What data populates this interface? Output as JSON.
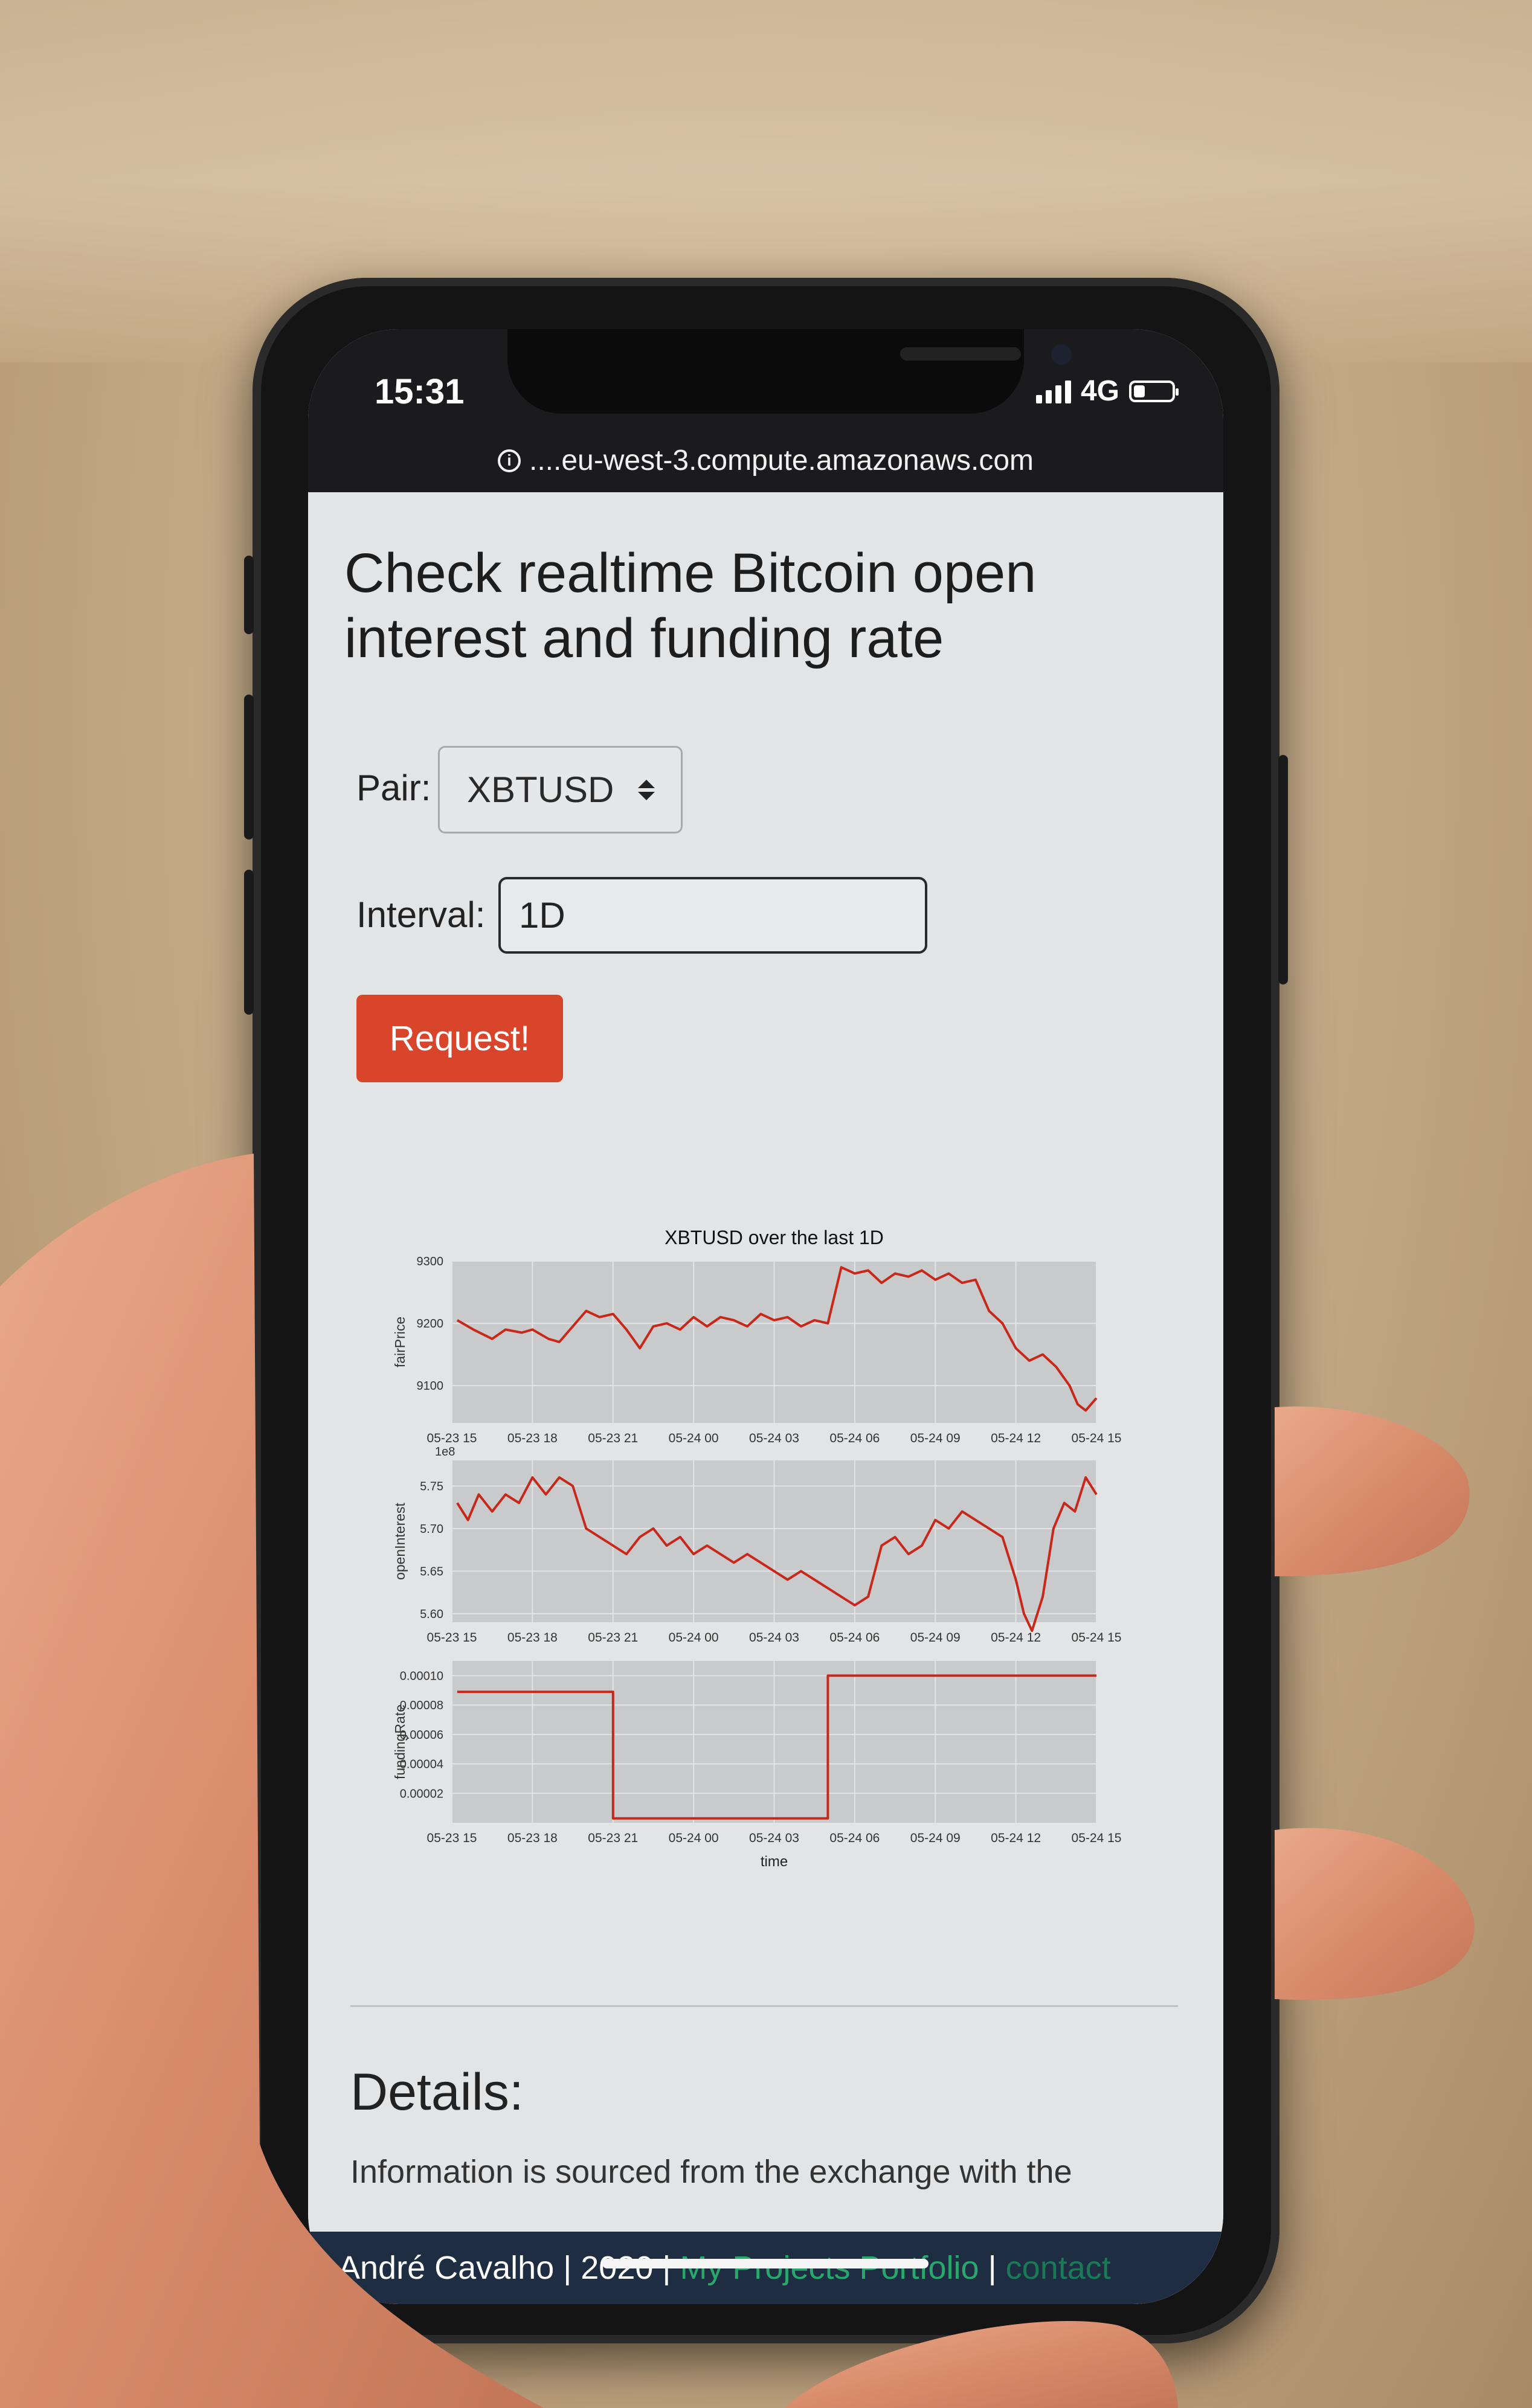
{
  "status": {
    "time": "15:31",
    "network": "4G",
    "battery_level": 0.3
  },
  "url_bar": {
    "url": "....eu-west-3.compute.amazonaws.com"
  },
  "page": {
    "title": "Check realtime Bitcoin open interest and funding rate",
    "pair_label": "Pair:",
    "pair_value": "XBTUSD",
    "interval_label": "Interval:",
    "interval_value": "1D",
    "request_button": "Request!",
    "details_title": "Details:",
    "details_text": "Information is sourced from the exchange with the"
  },
  "footer": {
    "author": "André Cavalho | 2020 |",
    "portfolio_link": "My Projects Portfolio",
    "separator": "|",
    "contact_link": "contact"
  },
  "colors": {
    "accent_button": "#d9452a",
    "series_line": "#c8281a",
    "plot_bg": "#c9cacc",
    "footer_bg": "#1e2d42",
    "footer_link": "#28a96b"
  },
  "icons": [
    "info-icon",
    "signal-icon",
    "battery-icon",
    "select-arrows-icon"
  ],
  "chart_data": {
    "type": "line",
    "title": "XBTUSD over the last 1D",
    "xlabel": "time",
    "x_tick_labels": [
      "05-23 15",
      "05-23 18",
      "05-23 21",
      "05-24 00",
      "05-24 03",
      "05-24 06",
      "05-24 09",
      "05-24 12",
      "05-24 15"
    ],
    "x_hours": [
      0,
      3,
      6,
      9,
      12,
      15,
      18,
      21,
      24
    ],
    "panels": [
      {
        "ylabel": "fairPrice",
        "ylim": [
          9040,
          9300
        ],
        "yticks": [
          9100,
          9200,
          9300
        ],
        "ytick_labels": [
          "9100",
          "9200",
          "9300"
        ],
        "offset_label": "",
        "step": false,
        "x": [
          0.2,
          0.8,
          1.5,
          2.0,
          2.6,
          3.0,
          3.6,
          4.0,
          4.5,
          5.0,
          5.5,
          6.0,
          6.5,
          7.0,
          7.5,
          8.0,
          8.5,
          9.0,
          9.5,
          10.0,
          10.5,
          11.0,
          11.5,
          12.0,
          12.5,
          13.0,
          13.5,
          14.0,
          14.5,
          15.0,
          15.5,
          16.0,
          16.5,
          17.0,
          17.5,
          18.0,
          18.5,
          19.0,
          19.5,
          20.0,
          20.5,
          21.0,
          21.5,
          22.0,
          22.5,
          23.0,
          23.3,
          23.6,
          24.0
        ],
        "y": [
          9205,
          9190,
          9175,
          9190,
          9185,
          9190,
          9175,
          9170,
          9195,
          9220,
          9210,
          9215,
          9190,
          9160,
          9195,
          9200,
          9190,
          9210,
          9195,
          9210,
          9205,
          9195,
          9215,
          9205,
          9210,
          9195,
          9205,
          9200,
          9290,
          9280,
          9285,
          9265,
          9280,
          9275,
          9285,
          9270,
          9280,
          9265,
          9270,
          9220,
          9200,
          9160,
          9140,
          9150,
          9130,
          9100,
          9070,
          9060,
          9080
        ]
      },
      {
        "ylabel": "openInterest",
        "ylim": [
          5.59,
          5.78
        ],
        "yticks": [
          5.6,
          5.65,
          5.7,
          5.75
        ],
        "ytick_labels": [
          "5.60",
          "5.65",
          "5.70",
          "5.75"
        ],
        "offset_label": "1e8",
        "step": false,
        "x": [
          0.2,
          0.6,
          1.0,
          1.5,
          2.0,
          2.5,
          3.0,
          3.5,
          4.0,
          4.5,
          5.0,
          5.5,
          6.0,
          6.5,
          7.0,
          7.5,
          8.0,
          8.5,
          9.0,
          9.5,
          10.0,
          10.5,
          11.0,
          11.5,
          12.0,
          12.5,
          13.0,
          13.5,
          14.0,
          14.5,
          15.0,
          15.5,
          16.0,
          16.5,
          17.0,
          17.5,
          18.0,
          18.5,
          19.0,
          19.5,
          20.0,
          20.5,
          21.0,
          21.3,
          21.6,
          22.0,
          22.4,
          22.8,
          23.2,
          23.6,
          24.0
        ],
        "y": [
          5.73,
          5.71,
          5.74,
          5.72,
          5.74,
          5.73,
          5.76,
          5.74,
          5.76,
          5.75,
          5.7,
          5.69,
          5.68,
          5.67,
          5.69,
          5.7,
          5.68,
          5.69,
          5.67,
          5.68,
          5.67,
          5.66,
          5.67,
          5.66,
          5.65,
          5.64,
          5.65,
          5.64,
          5.63,
          5.62,
          5.61,
          5.62,
          5.68,
          5.69,
          5.67,
          5.68,
          5.71,
          5.7,
          5.72,
          5.71,
          5.7,
          5.69,
          5.64,
          5.6,
          5.58,
          5.62,
          5.7,
          5.73,
          5.72,
          5.76,
          5.74
        ]
      },
      {
        "ylabel": "fundingRate",
        "ylim": [
          0.0,
          0.00011
        ],
        "yticks": [
          2e-05,
          4e-05,
          6e-05,
          8e-05,
          0.0001
        ],
        "ytick_labels": [
          "0.00002",
          "0.00004",
          "0.00006",
          "0.00008",
          "0.00010"
        ],
        "offset_label": "",
        "step": true,
        "x": [
          0.2,
          6.0,
          6.0,
          14.0,
          14.0,
          24.0
        ],
        "y": [
          8.9e-05,
          8.9e-05,
          3e-06,
          3e-06,
          0.0001,
          0.0001
        ]
      }
    ]
  }
}
